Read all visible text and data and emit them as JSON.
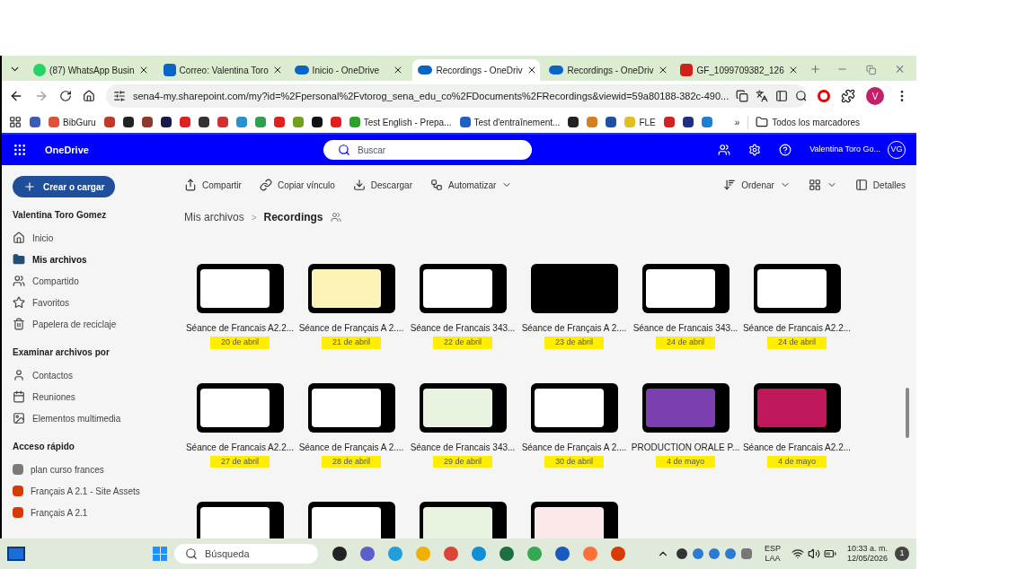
{
  "tabs": [
    {
      "label": "(87) WhatsApp Busin",
      "selected": false
    },
    {
      "label": "Correo: Valentina Toro",
      "selected": false
    },
    {
      "label": "Inicio - OneDrive",
      "selected": false
    },
    {
      "label": "Recordings - OneDriv",
      "selected": true
    },
    {
      "label": "Recordings - OneDriv",
      "selected": false
    },
    {
      "label": "GF_1099709382_126",
      "selected": false
    }
  ],
  "address": {
    "url": "sena4-my.sharepoint.com/my?id=%2Fpersonal%2Fvtorog_sena_edu_co%2FDocuments%2FRecordings&viewid=59a80188-382c-490...",
    "profile": "V"
  },
  "bookmarks": [
    {
      "kind": "icon",
      "color": "#3b5bb5"
    },
    {
      "kind": "link",
      "label": "BibGuru",
      "color": "#e0513a"
    },
    {
      "kind": "icon",
      "color": "#c0392b"
    },
    {
      "kind": "icon",
      "color": "#222222"
    },
    {
      "kind": "icon",
      "color": "#8b3a2b"
    },
    {
      "kind": "icon",
      "color": "#1a1a4a"
    },
    {
      "kind": "icon",
      "color": "#e02020"
    },
    {
      "kind": "icon",
      "color": "#333333"
    },
    {
      "kind": "icon",
      "color": "#d03030"
    },
    {
      "kind": "icon",
      "color": "#2a90d0"
    },
    {
      "kind": "icon",
      "color": "#30a050"
    },
    {
      "kind": "icon",
      "color": "#e02020"
    },
    {
      "kind": "icon",
      "color": "#70a020"
    },
    {
      "kind": "icon",
      "color": "#111111"
    },
    {
      "kind": "icon",
      "color": "#e02020"
    },
    {
      "kind": "link",
      "label": "Test English - Prepa...",
      "color": "#2ca02c"
    },
    {
      "kind": "link",
      "label": "Test d'entraînement...",
      "color": "#2060c0"
    },
    {
      "kind": "icon",
      "color": "#222222"
    },
    {
      "kind": "icon",
      "color": "#d08020"
    },
    {
      "kind": "icon",
      "color": "#2050a0"
    },
    {
      "kind": "link",
      "label": "FLE",
      "color": "#e0c020"
    },
    {
      "kind": "icon",
      "color": "#d02020"
    },
    {
      "kind": "icon",
      "color": "#203080"
    },
    {
      "kind": "icon",
      "color": "#2080d0"
    }
  ],
  "bookmarks_more": "»",
  "all_bookmarks": "Todos los marcadores",
  "app": {
    "name": "OneDrive",
    "search_placeholder": "Buscar",
    "user": "Valentina Toro Go...",
    "initials": "VG"
  },
  "create_button": "Crear o cargar",
  "sidebar": [
    {
      "kind": "header",
      "label": "Valentina Toro Gomez"
    },
    {
      "kind": "item",
      "label": "Inicio",
      "selected": false
    },
    {
      "kind": "item",
      "label": "Mis archivos",
      "selected": true
    },
    {
      "kind": "item",
      "label": "Compartido",
      "selected": false
    },
    {
      "kind": "item",
      "label": "Favoritos",
      "selected": false
    },
    {
      "kind": "item",
      "label": "Papelera de reciclaje",
      "selected": false
    },
    {
      "kind": "header",
      "label": "Examinar archivos por"
    },
    {
      "kind": "item",
      "label": "Contactos",
      "selected": false
    },
    {
      "kind": "item",
      "label": "Reuniones",
      "selected": false
    },
    {
      "kind": "item",
      "label": "Elementos multimedia",
      "selected": false
    },
    {
      "kind": "header",
      "label": "Acceso rápido"
    },
    {
      "kind": "site",
      "label": "plan curso frances",
      "color": "#7a7a7a",
      "selected": false
    },
    {
      "kind": "site",
      "label": "Français A 2.1 - Site Assets",
      "color": "#d83b01",
      "selected": false
    },
    {
      "kind": "site",
      "label": "Français A 2.1",
      "color": "#d83b01",
      "selected": false
    }
  ],
  "toolbar": {
    "left": [
      "Compartir",
      "Copiar vínculo",
      "Descargar",
      "Automatizar"
    ],
    "right": [
      "Ordenar",
      "Detalles"
    ]
  },
  "breadcrumb": {
    "parent": "Mis archivos",
    "separator": ">",
    "current": "Recordings"
  },
  "files": [
    {
      "name": "Séance de Francais A2.2...",
      "date": "20 de abril",
      "highlighted": true
    },
    {
      "name": "Séance de Français A 2....",
      "date": "21 de abril",
      "highlighted": true
    },
    {
      "name": "Séance de Francais 343...",
      "date": "22 de abril",
      "highlighted": true
    },
    {
      "name": "Séance de Français A 2....",
      "date": "23 de abril",
      "highlighted": true
    },
    {
      "name": "Séance de Francais 343...",
      "date": "24 de abril",
      "highlighted": true
    },
    {
      "name": "Séance de Francais A2.2...",
      "date": "24 de abril",
      "highlighted": true
    },
    {
      "name": "Séance de Francais A2.2...",
      "date": "27 de abril",
      "highlighted": true
    },
    {
      "name": "Séance de Français A 2....",
      "date": "28 de abril",
      "highlighted": true
    },
    {
      "name": "Séance de Francais 343...",
      "date": "29 de abril",
      "highlighted": true
    },
    {
      "name": "Séance de Français A 2....",
      "date": "30 de abril",
      "highlighted": true
    },
    {
      "name": "PRODUCTION ORALE P...",
      "date": "4 de mayo",
      "highlighted": true
    },
    {
      "name": "Séance de Francais A2.2...",
      "date": "4 de mayo",
      "highlighted": true
    }
  ],
  "taskbar": {
    "search_placeholder": "Búsqueda",
    "language": "ESP",
    "layout": "LAA",
    "time": "10:33 a. m.",
    "date": "12/05/2026",
    "notifications": "1",
    "apps": [
      {
        "color": "#222222"
      },
      {
        "color": "#5b5fc7"
      },
      {
        "color": "#229ed9"
      },
      {
        "color": "#f0b000"
      },
      {
        "color": "#db4437"
      },
      {
        "color": "#0f8fd6"
      },
      {
        "color": "#1d6f42"
      },
      {
        "color": "#34a853"
      },
      {
        "color": "#185abd"
      },
      {
        "color": "#ff7139"
      },
      {
        "color": "#d83b01"
      }
    ]
  }
}
